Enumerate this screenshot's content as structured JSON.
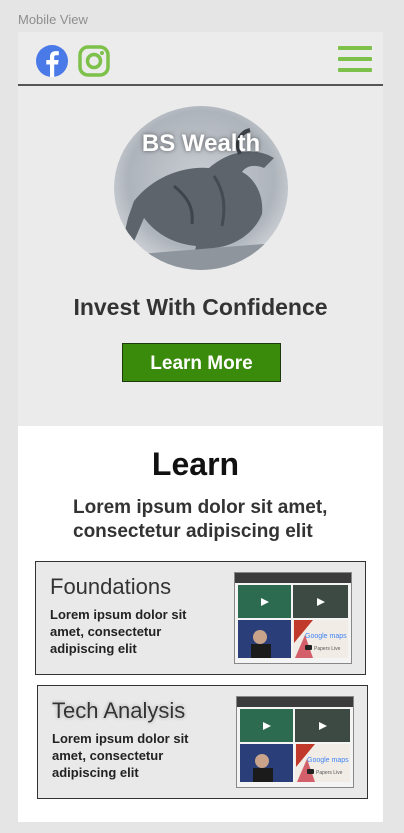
{
  "frame_label": "Mobile View",
  "header": {
    "social": [
      "facebook-icon",
      "instagram-icon"
    ],
    "menu_icon": "hamburger-menu-icon"
  },
  "hero": {
    "logo_text": "BS Wealth",
    "tagline": "Invest With Confidence",
    "cta_label": "Learn More"
  },
  "learn": {
    "title": "Learn",
    "subtitle": "Lorem ipsum dolor sit amet, consectetur adipiscing elit",
    "cards": [
      {
        "title": "Foundations",
        "description": "Lorem ipsum dolor sit amet, consectetur adipiscing elit"
      },
      {
        "title": "Tech Analysis",
        "description": "Lorem ipsum dolor sit amet, consectetur adipiscing elit"
      }
    ],
    "thumbnail_labels": {
      "maps": "Google maps",
      "live": "Papers Live"
    }
  },
  "colors": {
    "accent_green": "#7dc14b",
    "cta_green": "#3a8a0b",
    "facebook_blue": "#4a79e8"
  }
}
